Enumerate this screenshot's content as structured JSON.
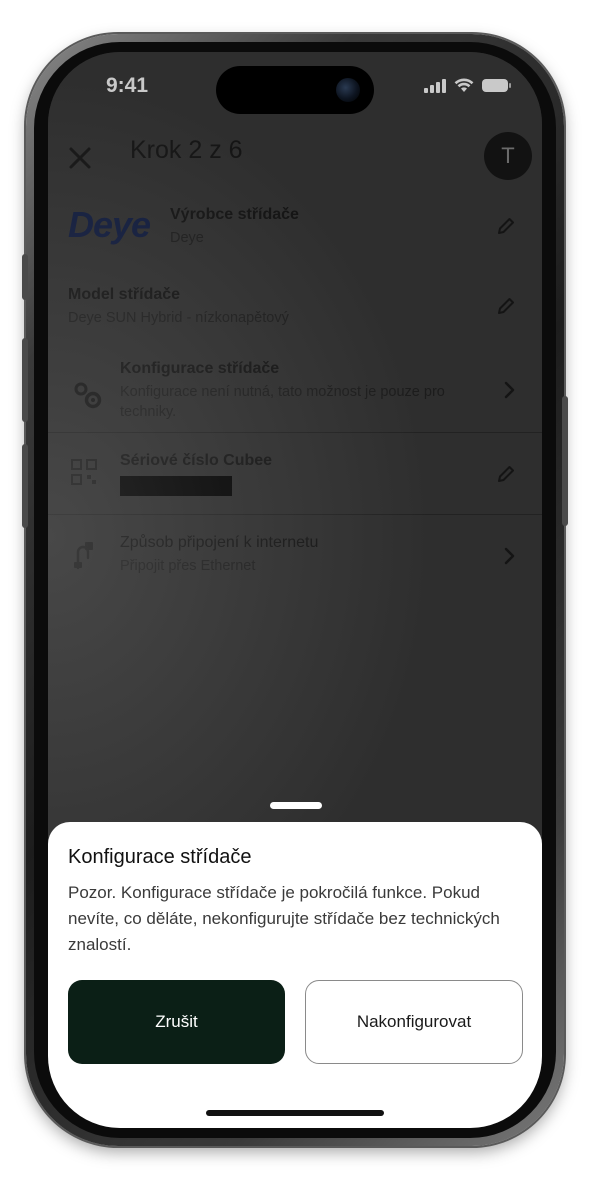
{
  "status_bar": {
    "time": "9:41"
  },
  "header": {
    "title": "Krok 2 z 6",
    "avatar_initial": "T"
  },
  "rows": {
    "manufacturer": {
      "logo_text": "Deye",
      "title": "Výrobce střídače",
      "value": "Deye"
    },
    "model": {
      "title": "Model střídače",
      "value": "Deye SUN Hybrid - nízkonapětový"
    },
    "configuration": {
      "title": "Konfigurace střídače",
      "value": "Konfigurace není nutná, tato možnost je pouze pro techniky."
    },
    "serial": {
      "title": "Sériové číslo Cubee"
    },
    "connection": {
      "title": "Způsob připojení k internetu",
      "value": "Připojit přes Ethernet"
    }
  },
  "sheet": {
    "title": "Konfigurace střídače",
    "body": "Pozor. Konfigurace střídače je pokročilá funkce. Pokud nevíte, co děláte, nekonfigurujte střídače bez technických znalostí.",
    "cancel_label": "Zrušit",
    "configure_label": "Nakonfigurovat"
  },
  "colors": {
    "primary_button": "#0b1f16",
    "overlay": "#2e2e2e",
    "sheet_background": "#ffffff"
  }
}
